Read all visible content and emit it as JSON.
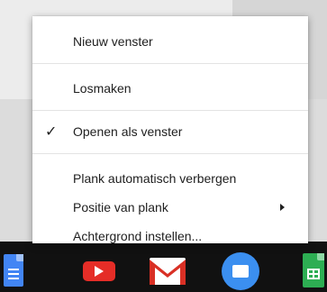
{
  "context_menu": {
    "items": [
      {
        "label": "Nieuw venster",
        "checked": false,
        "submenu": false
      },
      {
        "label": "Losmaken",
        "checked": false,
        "submenu": false
      },
      {
        "label": "Openen als venster",
        "checked": true,
        "submenu": false
      },
      {
        "label": "Plank automatisch verbergen",
        "checked": false,
        "submenu": false
      },
      {
        "label": "Positie van plank",
        "checked": false,
        "submenu": true
      },
      {
        "label": "Achtergrond instellen...",
        "checked": false,
        "submenu": false
      }
    ],
    "check_glyph": "✓"
  },
  "shelf": {
    "apps": [
      {
        "icon": "google-docs-icon",
        "color": "#4285f4"
      },
      {
        "icon": "youtube-icon",
        "color": "#e52d27"
      },
      {
        "icon": "gmail-icon",
        "color": "#d93025"
      },
      {
        "icon": "files-icon",
        "color": "#3b8ff0"
      },
      {
        "icon": "google-sheets-icon",
        "color": "#2dae53"
      }
    ],
    "background": "#111111"
  }
}
